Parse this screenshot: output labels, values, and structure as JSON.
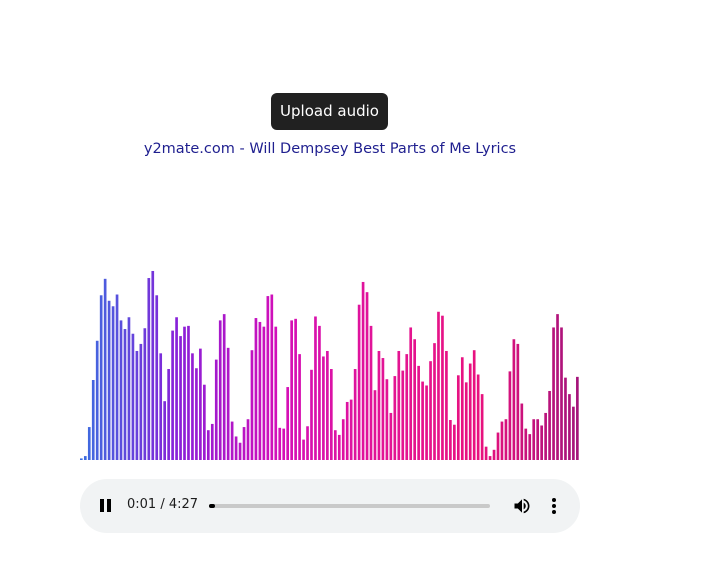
{
  "upload": {
    "label": "Upload audio"
  },
  "track": {
    "title": "y2mate.com - Will Dempsey Best Parts of Me Lyrics"
  },
  "player": {
    "current_time": "0:01",
    "duration": "4:27",
    "time_display": "0:01 / 4:27",
    "progress": 0.0045,
    "icons": {
      "play_pause": "pause-icon",
      "volume": "volume-icon",
      "more": "more-options-icon"
    }
  },
  "visualizer": {
    "max_level": 255,
    "levels": [
      2,
      5,
      42,
      102,
      152,
      210,
      231,
      203,
      196,
      211,
      178,
      167,
      182,
      161,
      139,
      148,
      168,
      232,
      241,
      210,
      136,
      75,
      116,
      165,
      182,
      158,
      170,
      171,
      136,
      117,
      142,
      96,
      38,
      46,
      128,
      178,
      186,
      143,
      49,
      30,
      22,
      42,
      52,
      140,
      181,
      176,
      170,
      209,
      211,
      170,
      41,
      40,
      93,
      178,
      180,
      135,
      26,
      43,
      115,
      183,
      171,
      132,
      139,
      116,
      38,
      32,
      52,
      74,
      77,
      116,
      198,
      227,
      214,
      171,
      89,
      139,
      130,
      103,
      60,
      107,
      139,
      114,
      135,
      169,
      154,
      120,
      100,
      95,
      126,
      149,
      189,
      184,
      139,
      51,
      45,
      108,
      131,
      99,
      123,
      140,
      109,
      84,
      17,
      5,
      13,
      35,
      49,
      52,
      113,
      154,
      148,
      72,
      40,
      33,
      52,
      52,
      44,
      60,
      88,
      169,
      186,
      169,
      105,
      84,
      68,
      106
    ],
    "gradient": [
      "#3a6fe0",
      "#8a1fd8",
      "#d40fb8",
      "#e21496",
      "#e8127e",
      "#a3137a"
    ]
  }
}
